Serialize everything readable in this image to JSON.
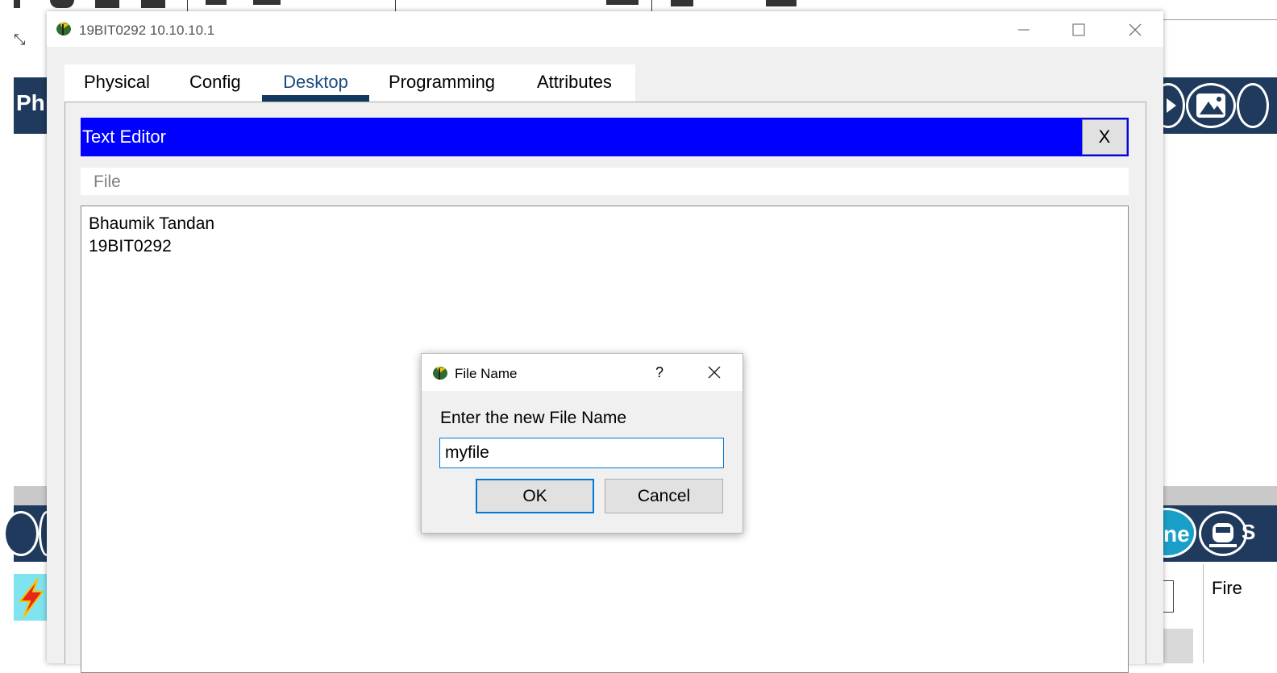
{
  "window": {
    "title": "19BIT0292 10.10.10.1",
    "tabs": [
      {
        "label": "Physical"
      },
      {
        "label": "Config"
      },
      {
        "label": "Desktop"
      },
      {
        "label": "Programming"
      },
      {
        "label": "Attributes"
      }
    ],
    "active_tab": "Desktop"
  },
  "editor": {
    "title": "Text Editor",
    "close_label": "X",
    "menu_file": "File",
    "content": "Bhaumik Tandan\n19BIT0292"
  },
  "dialog": {
    "title": "File Name",
    "help_label": "?",
    "prompt": "Enter the new File Name",
    "input_value": "myfile",
    "ok_label": "OK",
    "cancel_label": "Cancel"
  },
  "background": {
    "left_label": "Ph",
    "right_fragment": "ne",
    "right_fragment2": "S",
    "fire_label": "Fire"
  },
  "colors": {
    "editor_header": "#0000ff",
    "tab_active_underline": "#123a5e",
    "background_band": "#1f3a5c"
  }
}
